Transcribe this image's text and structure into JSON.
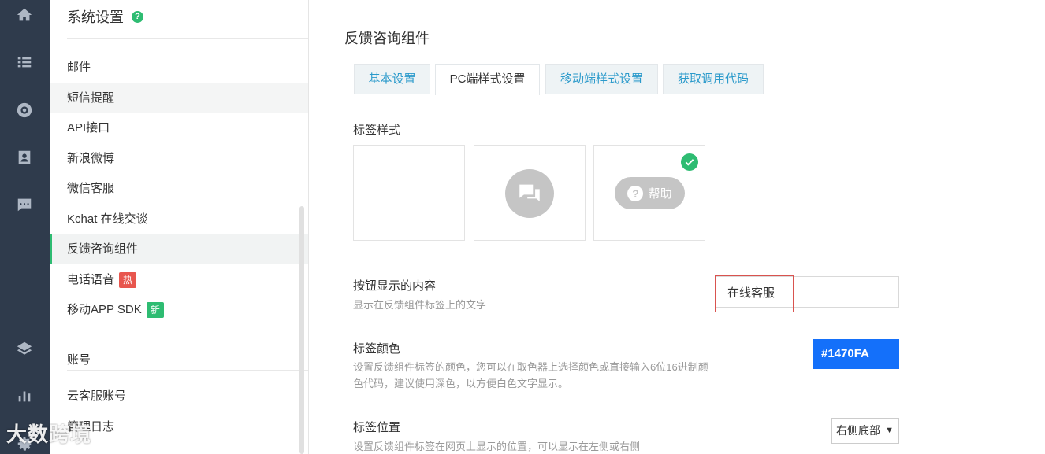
{
  "rail": {
    "icons": [
      "home-icon",
      "list-icon",
      "lifebuoy-icon",
      "contact-card-icon",
      "chat-icon",
      "layers-icon",
      "bar-chart-icon",
      "gear-icon"
    ]
  },
  "sidebar": {
    "title": "系统设置",
    "help_glyph": "?",
    "items": [
      {
        "label": "邮件"
      },
      {
        "label": "短信提醒"
      },
      {
        "label": "API接口"
      },
      {
        "label": "新浪微博"
      },
      {
        "label": "微信客服"
      },
      {
        "label": "Kchat 在线交谈"
      },
      {
        "label": "反馈咨询组件"
      },
      {
        "label": "电话语音",
        "badge": "热"
      },
      {
        "label": "移动APP SDK",
        "badge": "新"
      }
    ],
    "account_section": "账号",
    "account_items": [
      {
        "label": "云客服账号"
      },
      {
        "label": "管理日志"
      }
    ]
  },
  "main": {
    "title": "反馈咨询组件",
    "tabs": [
      {
        "label": "基本设置"
      },
      {
        "label": "PC端样式设置"
      },
      {
        "label": "移动端样式设置"
      },
      {
        "label": "获取调用代码"
      }
    ],
    "active_tab": "PC端样式设置",
    "label_style": {
      "title": "标签样式",
      "help_text": "帮助",
      "help_glyph": "?",
      "selected": 3
    },
    "button_content": {
      "title": "按钮显示的内容",
      "desc": "显示在反馈组件标签上的文字",
      "value": "在线客服"
    },
    "label_color": {
      "title": "标签颜色",
      "desc_line1": "设置反馈组件标签的颜色，您可以在取色器上选择颜色或直接输入6位16进制颜",
      "desc_line2": "色代码，建议使用深色，以方便白色文字显示。",
      "value": "#1470FA"
    },
    "label_position": {
      "title": "标签位置",
      "desc": "设置反馈组件标签在网页上显示的位置，可以显示在左侧或右侧",
      "selected": "右侧底部",
      "arrow": "▼"
    }
  },
  "watermark": "大数跨境"
}
